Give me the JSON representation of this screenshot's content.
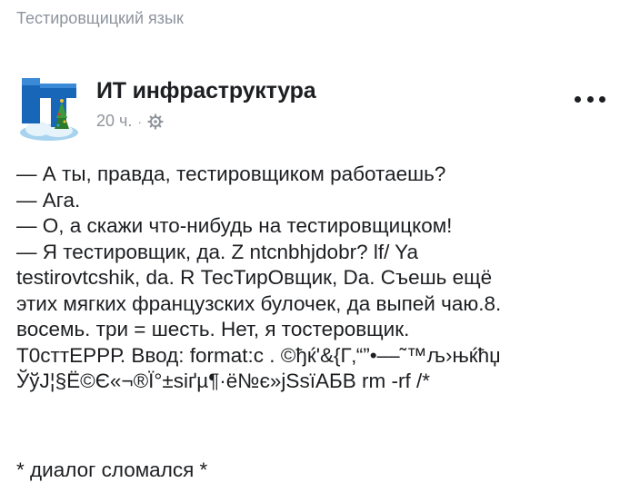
{
  "caption": "Тестировщицкий язык",
  "post": {
    "page_name": "ИТ инфраструктура",
    "time": "20 ч.",
    "separator": "·",
    "privacy_icon": "gear-icon",
    "more_icon": "more-dots-icon",
    "avatar_icon": "it-logo-avatar",
    "body_lines": [
      "— А ты, правда, тестировщиком работаешь?",
      "— Ага.",
      "— О, а скажи что-нибудь на тестировщицком!",
      "— Я тестировщик, да. Z ntcnbhjdobr? lf/ Ya",
      "testirovtcshik, da. R ТесТирОвщик, Da. Съешь ещё",
      "этих мягких французских булочек, да выпей чаю.8.",
      "восемь. три = шесть. Нет, я тостеровщик.",
      "Т0сттЕРРР. Ввод: format:c . ©ђќ'&{Г‚“”•––˜™љ›њќћџ",
      "ЎўЈ¦§Ё©Є«¬®Ї°±ѕіґµ¶·ё№є»јЅѕїАБВ rm -rf /*"
    ],
    "footer": "* диалог сломался *"
  }
}
